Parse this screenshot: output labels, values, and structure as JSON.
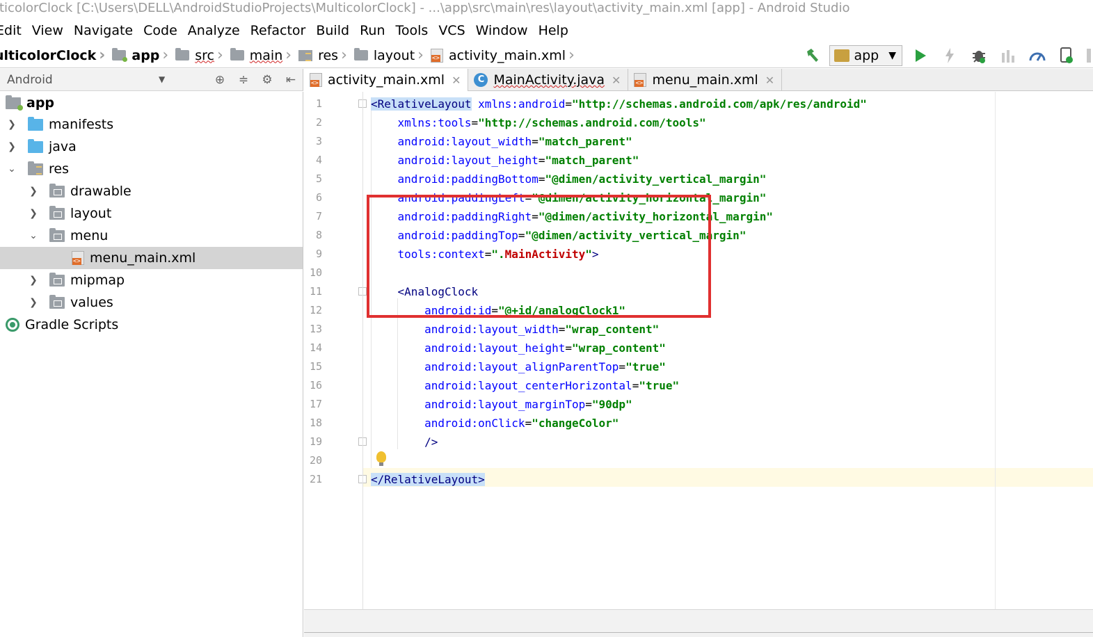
{
  "window": {
    "title": "lticolorClock [C:\\Users\\DELL\\AndroidStudioProjects\\MulticolorClock] - ...\\app\\src\\main\\res\\layout\\activity_main.xml [app] - Android Studio"
  },
  "menu": {
    "items": [
      "Edit",
      "View",
      "Navigate",
      "Code",
      "Analyze",
      "Refactor",
      "Build",
      "Run",
      "Tools",
      "VCS",
      "Window",
      "Help"
    ]
  },
  "breadcrumb": {
    "items": [
      "ulticolorClock",
      "app",
      "src",
      "main",
      "res",
      "layout",
      "activity_main.xml"
    ]
  },
  "toolbar": {
    "run_config": "app"
  },
  "project_panel": {
    "view_selector": "Android",
    "tree": [
      {
        "label": "app",
        "icon": "app-folder-icon"
      },
      {
        "label": "manifests",
        "icon": "folder-icon"
      },
      {
        "label": "java",
        "icon": "folder-icon"
      },
      {
        "label": "res",
        "icon": "res-folder-icon"
      },
      {
        "label": "drawable",
        "icon": "folder-icon"
      },
      {
        "label": "layout",
        "icon": "folder-icon"
      },
      {
        "label": "menu",
        "icon": "folder-icon"
      },
      {
        "label": "menu_main.xml",
        "icon": "xml-file-icon"
      },
      {
        "label": "mipmap",
        "icon": "folder-icon"
      },
      {
        "label": "values",
        "icon": "folder-icon"
      },
      {
        "label": "Gradle Scripts",
        "icon": "gradle-icon"
      }
    ]
  },
  "tabs": [
    {
      "label": "activity_main.xml",
      "active": true
    },
    {
      "label": "MainActivity.java",
      "active": false
    },
    {
      "label": "menu_main.xml",
      "active": false
    }
  ],
  "editor": {
    "line_numbers": [
      "1",
      "2",
      "3",
      "4",
      "5",
      "6",
      "7",
      "8",
      "9",
      "10",
      "11",
      "12",
      "13",
      "14",
      "15",
      "16",
      "17",
      "18",
      "19",
      "20",
      "21"
    ],
    "code": {
      "l1_tag": "RelativeLayout",
      "l1_attr": "xmlns:android",
      "l1_val": "\"http://schemas.android.com/apk/res/android\"",
      "l2_attr": "xmlns:tools",
      "l2_val": "\"http://schemas.android.com/tools\"",
      "l3_attr": "android:layout_width",
      "l3_val": "\"match_parent\"",
      "l4_attr": "android:layout_height",
      "l4_val": "\"match_parent\"",
      "l5_attr": "android:paddingBottom",
      "l5_val": "\"@dimen/activity_vertical_margin\"",
      "l6_attr": "android:paddingLeft",
      "l6_val": "\"@dimen/activity_horizontal_margin\"",
      "l7_attr": "android:paddingRight",
      "l7_val": "\"@dimen/activity_horizontal_margin\"",
      "l8_attr": "android:paddingTop",
      "l8_val": "\"@dimen/activity_vertical_margin\"",
      "l9_attr": "tools:context",
      "l9_val_a": "\".",
      "l9_val_b": "MainActivity",
      "l9_val_c": "\"",
      "l11_tag": "AnalogClock",
      "l12_attr": "android:id",
      "l12_val": "\"@+id/analogClock1\"",
      "l13_attr": "android:layout_width",
      "l13_val": "\"wrap_content\"",
      "l14_attr": "android:layout_height",
      "l14_val": "\"wrap_content\"",
      "l15_attr": "android:layout_alignParentTop",
      "l15_val": "\"true\"",
      "l16_attr": "android:layout_centerHorizontal",
      "l16_val": "\"true\"",
      "l17_attr": "android:layout_marginTop",
      "l17_val": "\"90dp\"",
      "l18_attr": "android:onClick",
      "l18_val": "\"changeColor\"",
      "l19": "/>",
      "l21_tag": "RelativeLayout"
    }
  },
  "colors": {
    "highlight_box": "#e03030",
    "tag": "#000080",
    "attribute": "#0000ff",
    "value": "#008000"
  }
}
